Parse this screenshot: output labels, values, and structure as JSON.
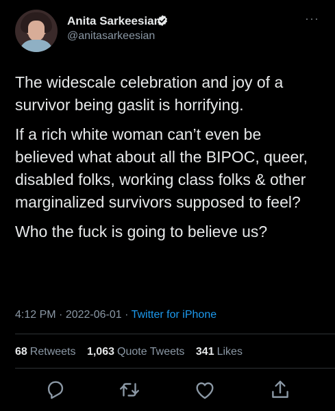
{
  "author": {
    "display_name": "Anita Sarkeesian",
    "handle": "@anitasarkeesian",
    "verified": true
  },
  "tweet": {
    "paragraphs": [
      "The widescale celebration and joy of a survivor being gaslit is horrifying.",
      "If a rich white woman can’t even be believed what about all the BIPOC, queer, disabled folks, working class folks & other marginalized survivors supposed to feel?",
      "Who the fuck is going to believe us?"
    ],
    "time": "4:12 PM",
    "date": "2022-06-01",
    "separator": "·",
    "source": "Twitter for iPhone"
  },
  "stats": {
    "retweets_count": "68",
    "retweets_label": "Retweets",
    "quotes_count": "1,063",
    "quotes_label": "Quote Tweets",
    "likes_count": "341",
    "likes_label": "Likes"
  },
  "actions": {
    "reply_icon": "reply-icon",
    "retweet_icon": "retweet-icon",
    "like_icon": "heart-icon",
    "share_icon": "share-icon"
  },
  "colors": {
    "background": "#000000",
    "text": "#e7e9ea",
    "secondary": "#8b98a5",
    "accent": "#1d9bf0",
    "divider": "#2f3336"
  }
}
